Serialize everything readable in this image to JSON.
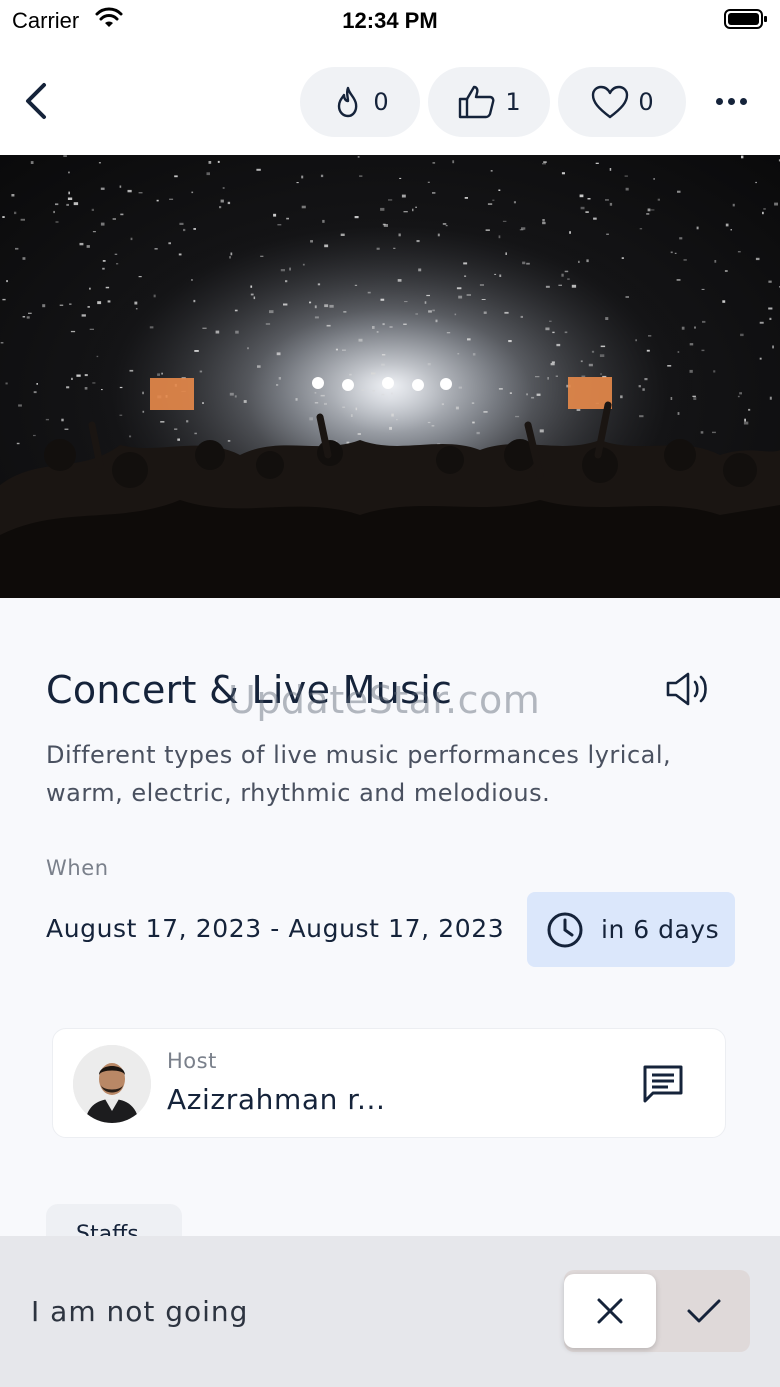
{
  "status_bar": {
    "carrier": "Carrier",
    "time": "12:34 PM"
  },
  "nav": {
    "back_icon": "chevron-left-icon",
    "reactions": [
      {
        "icon": "fire-icon",
        "count": "0"
      },
      {
        "icon": "thumbs-up-icon",
        "count": "1"
      },
      {
        "icon": "heart-icon",
        "count": "0"
      }
    ],
    "more_icon": "more-horizontal-icon"
  },
  "hero": {
    "icon": "concert-photo"
  },
  "event": {
    "title": "Concert & Live Music",
    "description": "Different types of live music performances lyrical, warm, electric, rhythmic and melodious.",
    "speaker_icon": "speaker-icon",
    "watermark": "UpdateStar.com",
    "when_label": "When",
    "dates": "August 17, 2023 - August 17, 2023",
    "countdown": "in 6 days",
    "countdown_icon": "clock-icon"
  },
  "host": {
    "label": "Host",
    "name": "Azizrahman r...",
    "chat_icon": "chat-icon"
  },
  "tabs": {
    "staffs": "Staffs"
  },
  "rsvp": {
    "status_text": "I am not going",
    "decline_icon": "close-icon",
    "accept_icon": "check-icon"
  },
  "colors": {
    "text_primary": "#15233a",
    "badge_bg": "#dbe7fb",
    "pill_bg": "#f0f2f5",
    "bottom_bar_bg": "#e6e7eb"
  }
}
